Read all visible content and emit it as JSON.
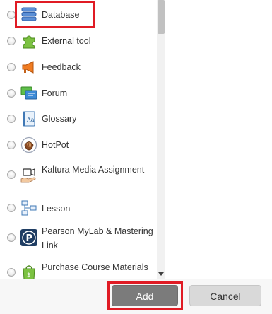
{
  "activities": [
    {
      "label": "Database",
      "icon": "database-icon"
    },
    {
      "label": "External tool",
      "icon": "puzzle-piece-icon"
    },
    {
      "label": "Feedback",
      "icon": "megaphone-icon"
    },
    {
      "label": "Forum",
      "icon": "forum-icon"
    },
    {
      "label": "Glossary",
      "icon": "glossary-book-icon"
    },
    {
      "label": "HotPot",
      "icon": "hotpot-icon"
    },
    {
      "label": "Kaltura Media Assignment",
      "icon": "kaltura-media-icon"
    },
    {
      "label": "Lesson",
      "icon": "lesson-flowchart-icon"
    },
    {
      "label": "Pearson MyLab & Mastering Link",
      "icon": "pearson-p-icon"
    },
    {
      "label": "Purchase Course Materials",
      "icon": "purchase-bag-icon"
    }
  ],
  "buttons": {
    "add": "Add",
    "cancel": "Cancel"
  },
  "colors": {
    "highlight": "#e01b24",
    "add_button": "#7b7b7b",
    "cancel_button": "#d9d9d9"
  }
}
